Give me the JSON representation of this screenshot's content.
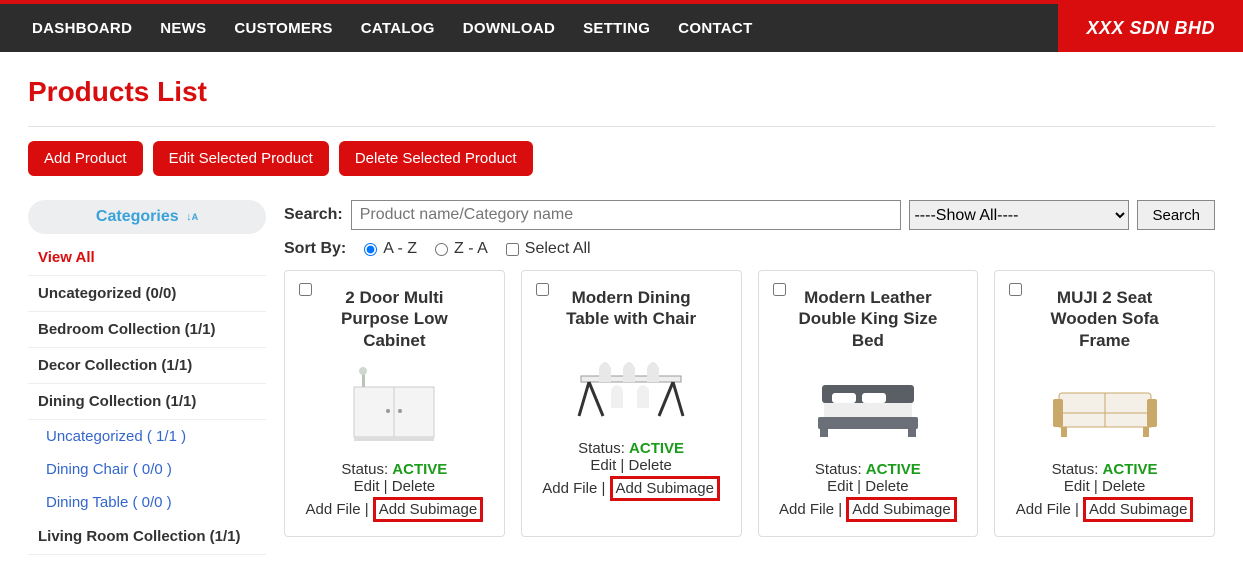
{
  "brand": "XXX SDN BHD",
  "nav": [
    "DASHBOARD",
    "NEWS",
    "CUSTOMERS",
    "CATALOG",
    "DOWNLOAD",
    "SETTING",
    "CONTACT"
  ],
  "page_title": "Products List",
  "actions": {
    "add": "Add Product",
    "edit": "Edit Selected Product",
    "del": "Delete Selected Product"
  },
  "sidebar": {
    "header": "Categories",
    "items": [
      {
        "label": "View All",
        "active": true
      },
      {
        "label": "Uncategorized (0/0)"
      },
      {
        "label": "Bedroom Collection (1/1)"
      },
      {
        "label": "Decor Collection (1/1)"
      },
      {
        "label": "Dining Collection (1/1)"
      }
    ],
    "subs": [
      {
        "label": "Uncategorized ( 1/1 )"
      },
      {
        "label": "Dining Chair ( 0/0 )"
      },
      {
        "label": "Dining Table ( 0/0 )"
      }
    ],
    "items2": [
      {
        "label": "Living Room Collection (1/1)"
      }
    ]
  },
  "search": {
    "label": "Search:",
    "placeholder": "Product name/Category name",
    "select_value": "----Show All----",
    "button": "Search"
  },
  "sort": {
    "label": "Sort By:",
    "opt_az": "A - Z",
    "opt_za": "Z - A",
    "select_all": "Select All"
  },
  "status_label": "Status:",
  "status_value": "ACTIVE",
  "links": {
    "edit": "Edit",
    "delete": "Delete",
    "addfile": "Add File",
    "addsub": "Add Subimage",
    "sep": " | "
  },
  "products": [
    {
      "title": "2 Door Multi Purpose Low Cabinet"
    },
    {
      "title": "Modern Dining Table with Chair"
    },
    {
      "title": "Modern Leather Double King Size Bed"
    },
    {
      "title": "MUJI 2 Seat Wooden Sofa Frame"
    }
  ]
}
